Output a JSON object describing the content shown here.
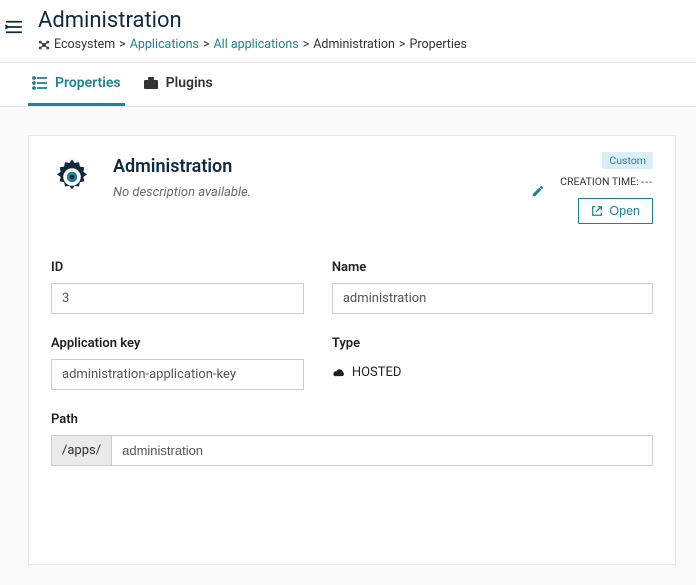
{
  "header": {
    "title": "Administration",
    "breadcrumb": {
      "root": "Ecosystem",
      "applications": "Applications",
      "all": "All applications",
      "admin": "Administration",
      "current": "Properties"
    }
  },
  "tabs": {
    "properties": "Properties",
    "plugins": "Plugins"
  },
  "card": {
    "name": "Administration",
    "description": "No description available.",
    "badge": "Custom",
    "creation_label": "CREATION TIME:",
    "creation_value": "---",
    "open": "Open"
  },
  "form": {
    "id_label": "ID",
    "id_value": "3",
    "name_label": "Name",
    "name_value": "administration",
    "key_label": "Application key",
    "key_value": "administration-application-key",
    "type_label": "Type",
    "type_value": "HOSTED",
    "path_label": "Path",
    "path_prefix": "/apps/",
    "path_value": "administration"
  }
}
